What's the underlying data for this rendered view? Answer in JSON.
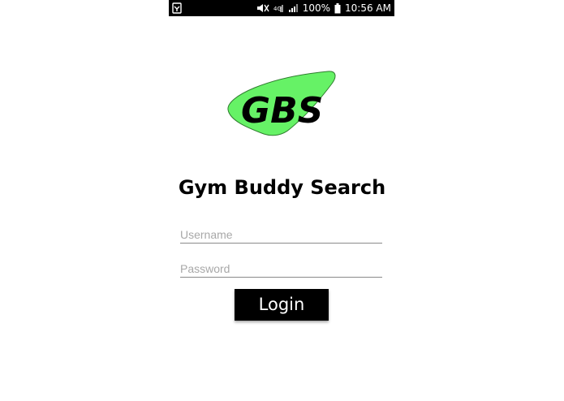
{
  "status_bar": {
    "battery_percent": "100%",
    "time": "10:56 AM",
    "icons": [
      "notification-icon",
      "mute-icon",
      "network-icon",
      "signal-icon",
      "battery-icon"
    ]
  },
  "logo": {
    "text": "GBS",
    "color": "#66f266"
  },
  "title": "Gym Buddy Search",
  "username": {
    "placeholder": "Username",
    "value": ""
  },
  "password": {
    "placeholder": "Password",
    "value": ""
  },
  "login_button": {
    "label": "Login"
  },
  "colors": {
    "status_bar_bg": "#000000",
    "button_bg": "#000000",
    "button_text": "#ffffff",
    "underline": "#8a8a8a"
  }
}
